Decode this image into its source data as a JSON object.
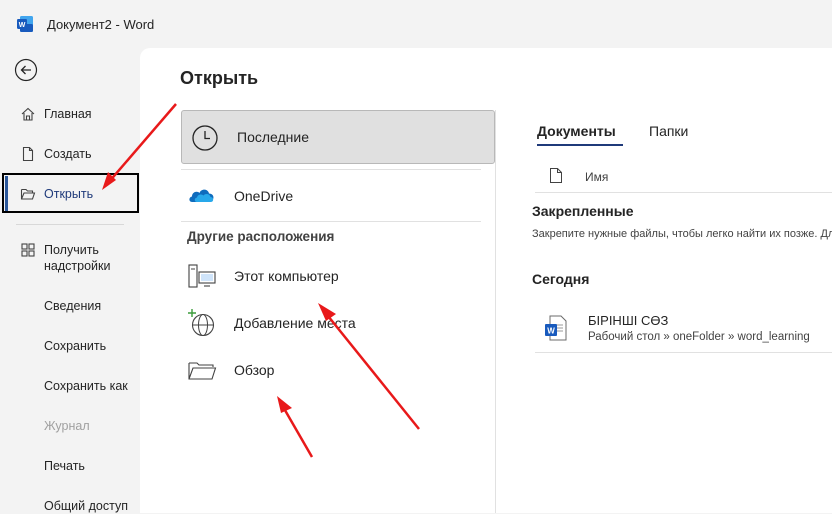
{
  "window": {
    "title": "Документ2  -  Word"
  },
  "sidebar": {
    "items": [
      {
        "label": "Главная"
      },
      {
        "label": "Создать"
      },
      {
        "label": "Открыть"
      },
      {
        "label": "Получить надстройки"
      },
      {
        "label": "Сведения"
      },
      {
        "label": "Сохранить"
      },
      {
        "label": "Сохранить как"
      },
      {
        "label": "Журнал"
      },
      {
        "label": "Печать"
      },
      {
        "label": "Общий доступ"
      }
    ]
  },
  "main": {
    "title": "Открыть",
    "locations": {
      "recent": "Последние",
      "onedrive": "OneDrive",
      "other_header": "Другие расположения",
      "this_pc": "Этот компьютер",
      "add_place": "Добавление места",
      "browse": "Обзор"
    },
    "tabs": {
      "documents": "Документы",
      "folders": "Папки"
    },
    "columns": {
      "name": "Имя"
    },
    "pinned": {
      "title": "Закрепленные",
      "description": "Закрепите нужные файлы, чтобы легко найти их позже. Для этого наведите указатель мыши на файл."
    },
    "today": {
      "title": "Сегодня",
      "files": [
        {
          "name": "БІРІНШІ СӨЗ",
          "path": "Рабочий стол » oneFolder » word_learning"
        }
      ]
    }
  },
  "colors": {
    "accent": "#2b579a",
    "annotation": "#e8191a"
  }
}
